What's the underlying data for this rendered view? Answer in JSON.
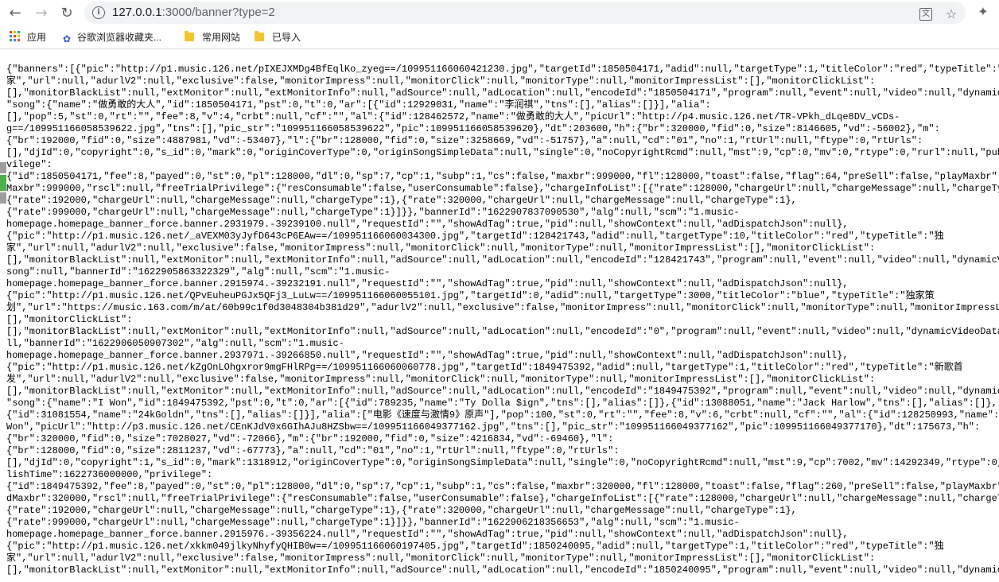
{
  "browser": {
    "back_icon": "arrow-left",
    "forward_icon": "arrow-right",
    "reload_icon": "reload",
    "url_host": "127.0.0.1",
    "url_rest": ":3000/banner?type=2",
    "colors": {
      "folder": "#f4c430",
      "omnibox_bg": "#f1f3f4",
      "icon": "#5f6368"
    }
  },
  "bookmarks": [
    {
      "label": "应用"
    },
    {
      "label": "谷歌浏览器收藏夹..."
    },
    {
      "label": "常用网站"
    },
    {
      "label": "已导入"
    }
  ],
  "json_lines": [
    "{\"banners\":[{\"pic\":\"http://p1.music.126.net/pIXEJXMDg4BfEqlKo_zyeg==/109951166060421230.jpg\",\"targetId\":1850504171,\"adid\":null,\"targetType\":1,\"titleColor\":\"red\",\"typeTitle\":\"独",
    "家\",\"url\":null,\"adurlV2\":null,\"exclusive\":false,\"monitorImpress\":null,\"monitorClick\":null,\"monitorType\":null,\"monitorImpressList\":[],\"monitorClickList\":",
    "[],\"monitorBlackList\":null,\"extMonitor\":null,\"extMonitorInfo\":null,\"adSource\":null,\"adLocation\":null,\"encodeId\":\"1850504171\",\"program\":null,\"event\":null,\"video\":null,\"dynamicVideo",
    "\"song\":{\"name\":\"做勇敢的大人\",\"id\":1850504171,\"pst\":0,\"t\":0,\"ar\":[{\"id\":12929031,\"name\":\"李润祺\",\"tns\":[],\"alias\":[]}],\"alia\":",
    "[],\"pop\":5,\"st\":0,\"rt\":\"\",\"fee\":8,\"v\":4,\"crbt\":null,\"cf\":\"\",\"al\":{\"id\":128462572,\"name\":\"做勇敢的大人\",\"picUrl\":\"http://p4.music.126.net/TR-VPkh_dLqe8DV_vCDs-",
    "g==/109951166058539622.jpg\",\"tns\":[],\"pic_str\":\"109951166058539622\",\"pic\":109951166058539620},\"dt\":203600,\"h\":{\"br\":320000,\"fid\":0,\"size\":8146605,\"vd\":-56002},\"m\":",
    "{\"br\":192000,\"fid\":0,\"size\":4887981,\"vd\":-53407},\"l\":{\"br\":128000,\"fid\":0,\"size\":3258669,\"vd\":-51757},\"a\":null,\"cd\":\"01\",\"no\":1,\"rtUrl\":null,\"ftype\":0,\"rtUrls\":",
    "[],\"djId\":0,\"copyright\":0,\"s_id\":0,\"mark\":0,\"originCoverType\":0,\"originSongSimpleData\":null,\"single\":0,\"noCopyrightRcmd\":null,\"mst\":9,\"cp\":0,\"mv\":0,\"rtype\":0,\"rurl\":null,\"publishT",
    "vilege\":",
    "{\"id\":1850504171,\"fee\":8,\"payed\":0,\"st\":0,\"pl\":128000,\"dl\":0,\"sp\":7,\"cp\":1,\"subp\":1,\"cs\":false,\"maxbr\":999000,\"fl\":128000,\"toast\":false,\"flag\":64,\"preSell\":false,\"playMaxbr\":99900",
    "Maxbr\":999000,\"rscl\":null,\"freeTrialPrivilege\":{\"resConsumable\":false,\"userConsumable\":false},\"chargeInfoList\":[{\"rate\":128000,\"chargeUrl\":null,\"chargeMessage\":null,\"chargeType\":0",
    "{\"rate\":192000,\"chargeUrl\":null,\"chargeMessage\":null,\"chargeType\":1},{\"rate\":320000,\"chargeUrl\":null,\"chargeMessage\":null,\"chargeType\":1},",
    "{\"rate\":999000,\"chargeUrl\":null,\"chargeMessage\":null,\"chargeType\":1}]}},\"bannerId\":\"1622907837090530\",\"alg\":null,\"scm\":\"1.music-",
    "homepage.homepage_banner_force.banner.2931979.-39239100.null\",\"requestId\":\"\",\"showAdTag\":true,\"pid\":null,\"showContext\":null,\"adDispatchJson\":null},",
    "{\"pic\":\"http://p1.music.126.net/_aVEXM03yJyfD643cP6EAw==/109951166060034300.jpg\",\"targetId\":128421743,\"adid\":null,\"targetType\":10,\"titleColor\":\"red\",\"typeTitle\":\"独",
    "家\",\"url\":null,\"adurlV2\":null,\"exclusive\":false,\"monitorImpress\":null,\"monitorClick\":null,\"monitorType\":null,\"monitorImpressList\":[],\"monitorClickList\":",
    "[],\"monitorBlackList\":null,\"extMonitor\":null,\"extMonitorInfo\":null,\"adSource\":null,\"adLocation\":null,\"encodeId\":\"128421743\",\"program\":null,\"event\":null,\"video\":null,\"dynamicVideoD",
    "song\":null,\"bannerId\":\"1622905863322329\",\"alg\":null,\"scm\":\"1.music-",
    "homepage.homepage_banner_force.banner.2915974.-39232191.null\",\"requestId\":\"\",\"showAdTag\":true,\"pid\":null,\"showContext\":null,\"adDispatchJson\":null},",
    "{\"pic\":\"http://p1.music.126.net/QPvEuheuPGJx5QFj3_LuLw==/109951166060055101.jpg\",\"targetId\":0,\"adid\":null,\"targetType\":3000,\"titleColor\":\"blue\",\"typeTitle\":\"独家策",
    "划\",\"url\":\"https://music.163.com/m/at/60b99c1f0d3048304b381d29\",\"adurlV2\":null,\"exclusive\":false,\"monitorImpress\":null,\"monitorClick\":null,\"monitorType\":null,\"monitorImpressList\":",
    "[],\"monitorClickList\":",
    "[],\"monitorBlackList\":null,\"extMonitor\":null,\"extMonitorInfo\":null,\"adSource\":null,\"adLocation\":null,\"encodeId\":\"0\",\"program\":null,\"event\":null,\"video\":null,\"dynamicVideoData\":nul",
    "ll,\"bannerId\":\"1622906050907302\",\"alg\":null,\"scm\":\"1.music-",
    "homepage.homepage_banner_force.banner.2937971.-39266850.null\",\"requestId\":\"\",\"showAdTag\":true,\"pid\":null,\"showContext\":null,\"adDispatchJson\":null},",
    "{\"pic\":\"http://p1.music.126.net/kZgOnLOhgxror9mgFHlRPg==/109951166060060778.jpg\",\"targetId\":1849475392,\"adid\":null,\"targetType\":1,\"titleColor\":\"red\",\"typeTitle\":\"新歌首",
    "发\",\"url\":null,\"adurlV2\":null,\"exclusive\":false,\"monitorImpress\":null,\"monitorClick\":null,\"monitorType\":null,\"monitorImpressList\":[],\"monitorClickList\":",
    "[],\"monitorBlackList\":null,\"extMonitor\":null,\"extMonitorInfo\":null,\"adSource\":null,\"adLocation\":null,\"encodeId\":\"1849475392\",\"program\":null,\"event\":null,\"video\":null,\"dynamicVideo",
    "\"song\":{\"name\":\"I Won\",\"id\":1849475392,\"pst\":0,\"t\":0,\"ar\":[{\"id\":789235,\"name\":\"Ty Dolla $ign\",\"tns\":[],\"alias\":[]},{\"id\":13088051,\"name\":\"Jack Harlow\",\"tns\":[],\"alias\":[]},",
    "{\"id\":31081554,\"name\":\"24kGoldn\",\"tns\":[],\"alias\":[]}],\"alia\":[\"电影《速度与激情9》原声\"],\"pop\":100,\"st\":0,\"rt\":\"\",\"fee\":8,\"v\":6,\"crbt\":null,\"cf\":\"\",\"al\":{\"id\":128250993,\"name\":\"I",
    "Won\",\"picUrl\":\"http://p3.music.126.net/CEnKJdV0x6GIhAJu8HZSbw==/109951166049377162.jpg\",\"tns\":[],\"pic_str\":\"109951166049377162\",\"pic\":109951166049377170},\"dt\":175673,\"h\":",
    "{\"br\":320000,\"fid\":0,\"size\":7028027,\"vd\":-72066},\"m\":{\"br\":192000,\"fid\":0,\"size\":4216834,\"vd\":-69460},\"l\":",
    "{\"br\":128000,\"fid\":0,\"size\":2811237,\"vd\":-67773},\"a\":null,\"cd\":\"01\",\"no\":1,\"rtUrl\":null,\"ftype\":0,\"rtUrls\":",
    "[],\"djId\":0,\"copyright\":1,\"s_id\":0,\"mark\":1318912,\"originCoverType\":0,\"originSongSimpleData\":null,\"single\":0,\"noCopyrightRcmd\":null,\"mst\":9,\"cp\":7002,\"mv\":14292349,\"rtype\":0,\"rurl",
    "lishTime\":1622736000000,\"privilege\":",
    "{\"id\":1849475392,\"fee\":8,\"payed\":0,\"st\":0,\"pl\":128000,\"dl\":0,\"sp\":7,\"cp\":1,\"subp\":1,\"cs\":false,\"maxbr\":320000,\"fl\":128000,\"toast\":false,\"flag\":260,\"preSell\":false,\"playMaxbr\"",
    "dMaxbr\":320000,\"rscl\":null,\"freeTrialPrivilege\":{\"resConsumable\":false,\"userConsumable\":false},\"chargeInfoList\":[{\"rate\":128000,\"chargeUrl\":null,\"chargeMessage\":null,\"chargeType\"",
    "{\"rate\":192000,\"chargeUrl\":null,\"chargeMessage\":null,\"chargeType\":1},{\"rate\":320000,\"chargeUrl\":null,\"chargeMessage\":null,\"chargeType\":1},",
    "{\"rate\":999000,\"chargeUrl\":null,\"chargeMessage\":null,\"chargeType\":1}]}},\"bannerId\":\"1622906218356653\",\"alg\":null,\"scm\":\"1.music-",
    "homepage.homepage_banner_force.banner.2915976.-39356224.null\",\"requestId\":\"\",\"showAdTag\":true,\"pid\":null,\"showContext\":null,\"adDispatchJson\":null},",
    "{\"pic\":\"http://p1.music.126.net/xkkm049jlkyNhyfyQHIB0w==/109951166060197405.jpg\",\"targetId\":1850240095,\"adid\":null,\"targetType\":1,\"titleColor\":\"red\",\"typeTitle\":\"独",
    "家\",\"url\":null,\"adurlV2\":null,\"exclusive\":false,\"monitorImpress\":null,\"monitorClick\":null,\"monitorType\":null,\"monitorImpressList\":[],\"monitorClickList\":",
    "[],\"monitorBlackList\":null,\"extMonitor\":null,\"extMonitorInfo\":null,\"adSource\":null,\"adLocation\":null,\"encodeId\":\"1850240095\",\"program\":null,\"event\":null,\"video\":null,\"dynamicVideo"
  ]
}
